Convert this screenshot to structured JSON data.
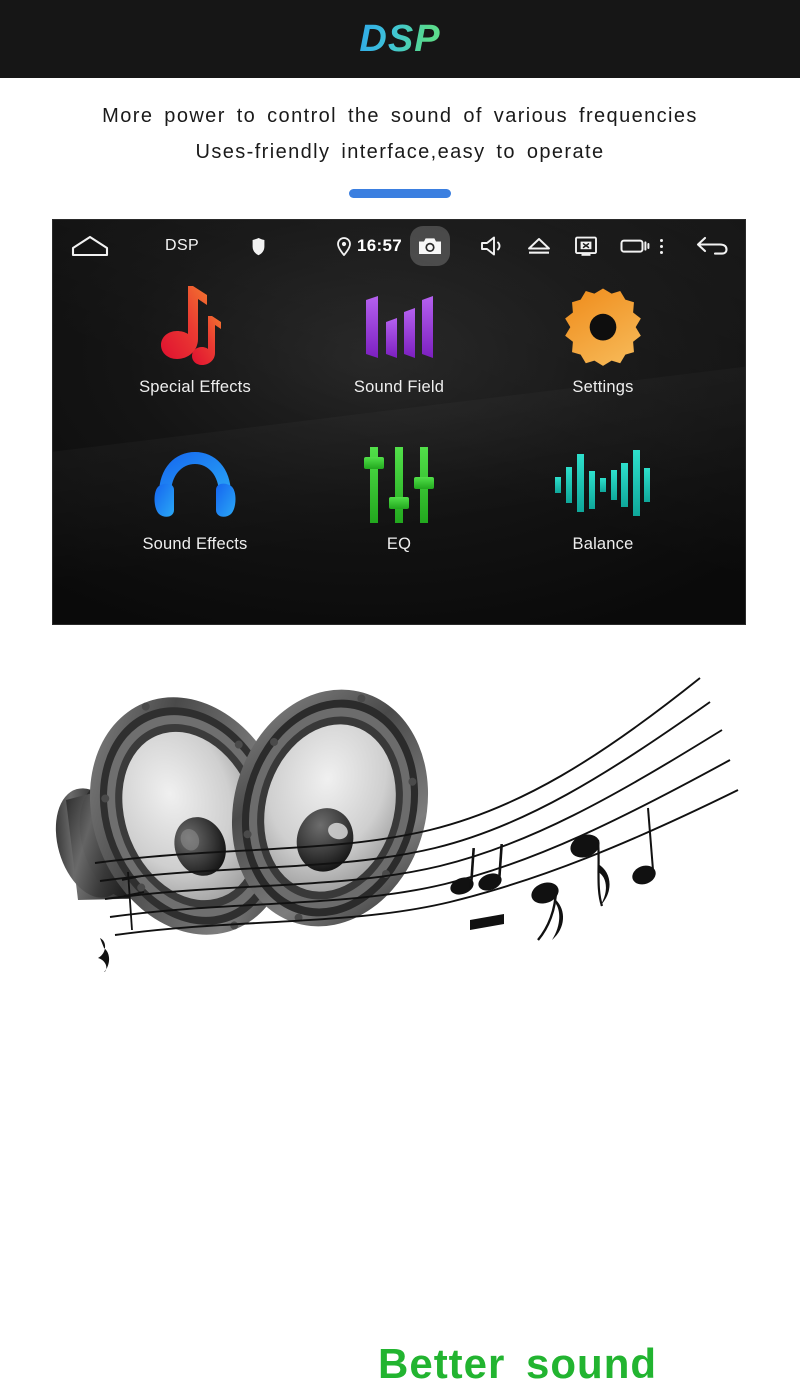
{
  "header": {
    "title": "DSP",
    "gradient_from": "#2fa8e8",
    "gradient_to": "#62e08c",
    "background": "#161616"
  },
  "tagline": {
    "line1": "More power to control the sound of various frequencies",
    "line2": "Uses-friendly interface,easy to operate",
    "accent_color": "#3b7fe0"
  },
  "device": {
    "status_bar": {
      "home_icon": "home-icon",
      "app_name": "DSP",
      "shield_icon": "shield-icon",
      "location_icon": "location-pin-icon",
      "time": "16:57",
      "camera_icon": "camera-icon",
      "volume_icon": "volume-speaker-icon",
      "eject_icon": "eject-icon",
      "screen_off_icon": "screen-off-icon",
      "recents_icon": "recent-apps-icon",
      "overflow_icon": "overflow-menu-icon",
      "back_icon": "back-arrow-icon"
    },
    "apps": [
      {
        "label": "Special Effects",
        "icon": "music-note-icon",
        "color": "#e8293a"
      },
      {
        "label": "Sound Field",
        "icon": "sound-field-bars-icon",
        "color": "#9a3fd6"
      },
      {
        "label": "Settings",
        "icon": "gear-icon",
        "color": "#e8962a"
      },
      {
        "label": "Sound Effects",
        "icon": "headphones-icon",
        "color": "#1a84f0"
      },
      {
        "label": "EQ",
        "icon": "equalizer-sliders-icon",
        "color": "#3ad23a"
      },
      {
        "label": "Balance",
        "icon": "waveform-icon",
        "color": "#19c8b4"
      }
    ]
  },
  "hero": {
    "title": "Better  sound",
    "title_color": "#22b430",
    "speakers_image": "speaker-drivers-photo",
    "music_staff_image": "musical-staff-notes-graphic"
  }
}
